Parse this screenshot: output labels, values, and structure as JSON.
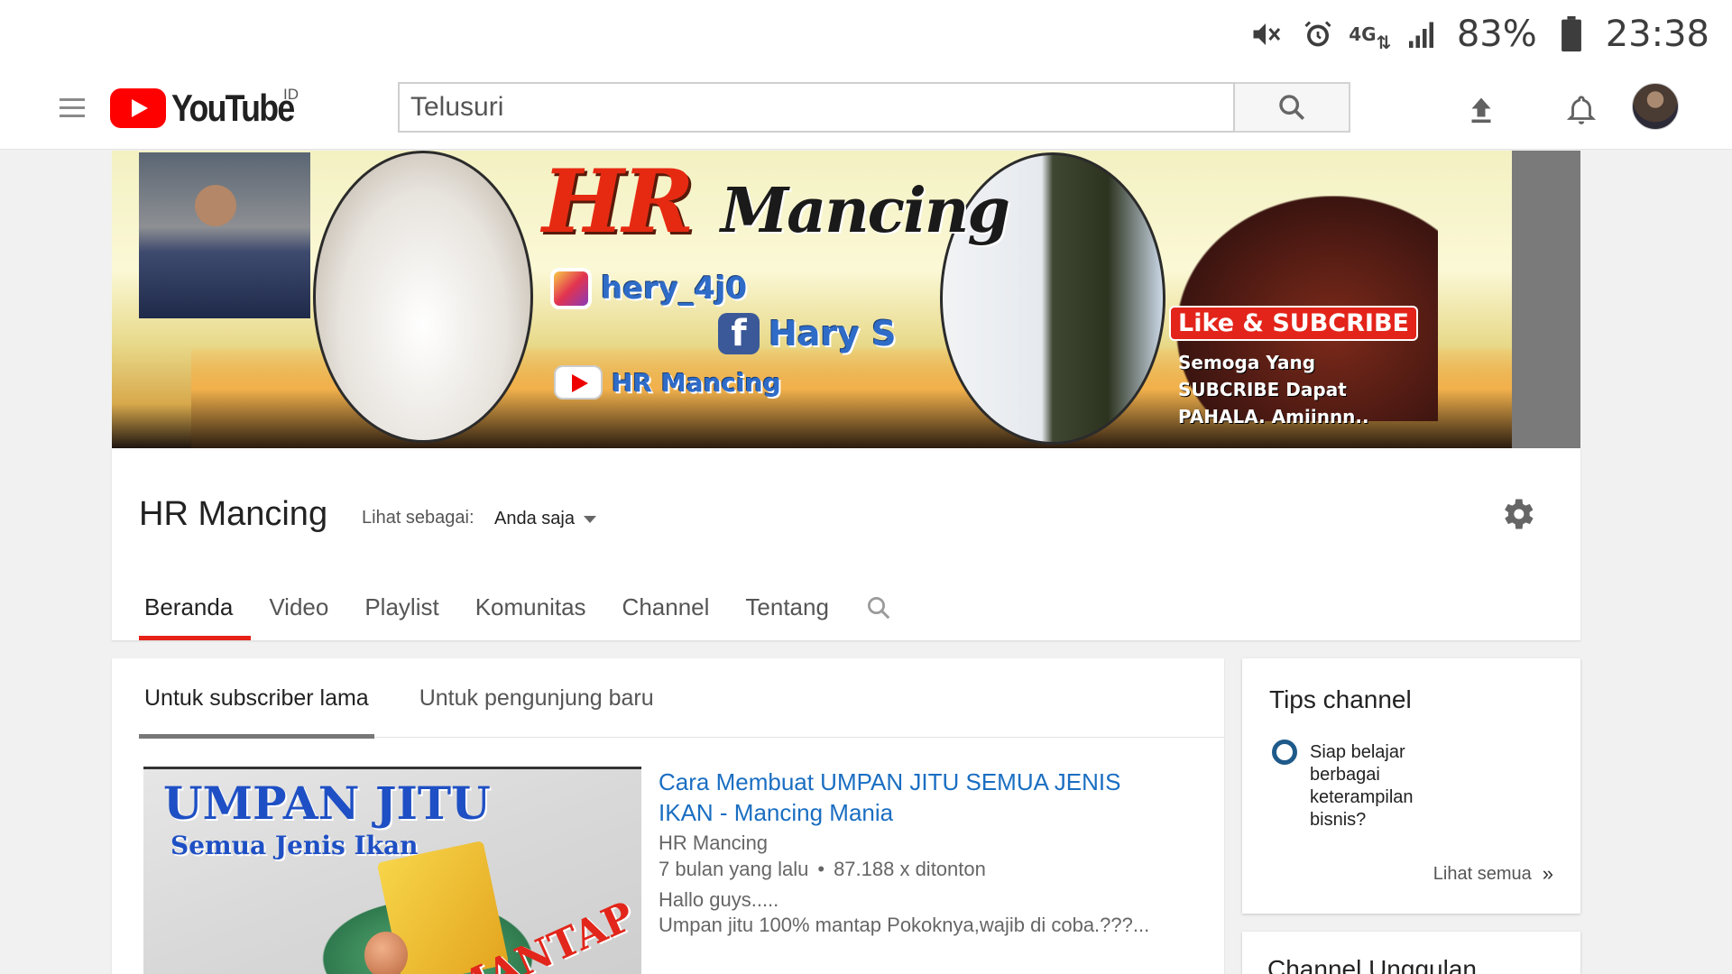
{
  "status_bar": {
    "battery_percent": "83%",
    "time": "23:38",
    "network": "4G",
    "icons": [
      "mute-icon",
      "alarm-icon",
      "4g-icon",
      "signal-icon",
      "battery-icon"
    ]
  },
  "header": {
    "logo_text": "YouTube",
    "region": "ID",
    "search_placeholder": "Telusuri",
    "icons": [
      "menu-icon",
      "search-icon",
      "upload-icon",
      "bell-icon",
      "avatar"
    ]
  },
  "banner": {
    "brand_first": "HR",
    "brand_second": "Mancing",
    "instagram": "hery_4j0",
    "facebook": "Hary S",
    "youtube": "HR Mancing",
    "cta": "Like & SUBCRIBE",
    "cta_sub": "Semoga Yang SUBCRIBE Dapat PAHALA. Amiinnn.."
  },
  "channel": {
    "name": "HR Mancing",
    "view_as_label": "Lihat sebagai:",
    "view_as_value": "Anda saja",
    "tabs": [
      {
        "label": "Beranda",
        "active": true
      },
      {
        "label": "Video",
        "active": false
      },
      {
        "label": "Playlist",
        "active": false
      },
      {
        "label": "Komunitas",
        "active": false
      },
      {
        "label": "Channel",
        "active": false
      },
      {
        "label": "Tentang",
        "active": false
      }
    ]
  },
  "main": {
    "subtabs": [
      {
        "label": "Untuk subscriber lama",
        "active": true
      },
      {
        "label": "Untuk pengunjung baru",
        "active": false
      }
    ],
    "video": {
      "thumb_title": "UMPAN JITU",
      "thumb_subtitle": "Semua Jenis Ikan",
      "thumb_stamp": "MANTAP",
      "title": "Cara Membuat UMPAN JITU SEMUA JENIS IKAN - Mancing Mania",
      "channel": "HR Mancing",
      "age": "7 bulan yang lalu",
      "separator": "•",
      "views": "87.188 x ditonton",
      "desc_line1": "Hallo guys.....",
      "desc_line2": "Umpan jitu 100% mantap Pokoknya,wajib di coba.???..."
    }
  },
  "tips": {
    "title": "Tips channel",
    "item": "Siap belajar berbagai keterampilan bisnis?",
    "see_all": "Lihat semua",
    "see_all_chevron": "»"
  },
  "featured": {
    "title": "Channel Unggulan"
  }
}
